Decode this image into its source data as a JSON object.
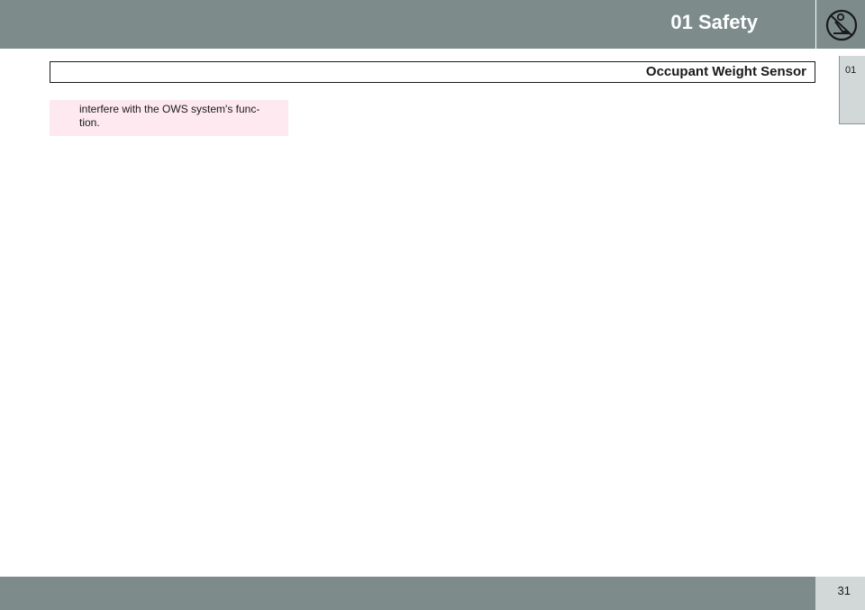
{
  "header": {
    "chapter_title": "01 Safety",
    "chapter_icon": "seated-person-icon"
  },
  "section": {
    "title": "Occupant Weight Sensor"
  },
  "side_tab": {
    "label": "01"
  },
  "note": {
    "text_line1": "interfere with the OWS system's func-",
    "text_line2": "tion."
  },
  "footer": {
    "page_number": "31"
  },
  "colors": {
    "band": "#7d8b8b",
    "tab": "#d2d8d8",
    "note_background": "#fde9ef"
  }
}
